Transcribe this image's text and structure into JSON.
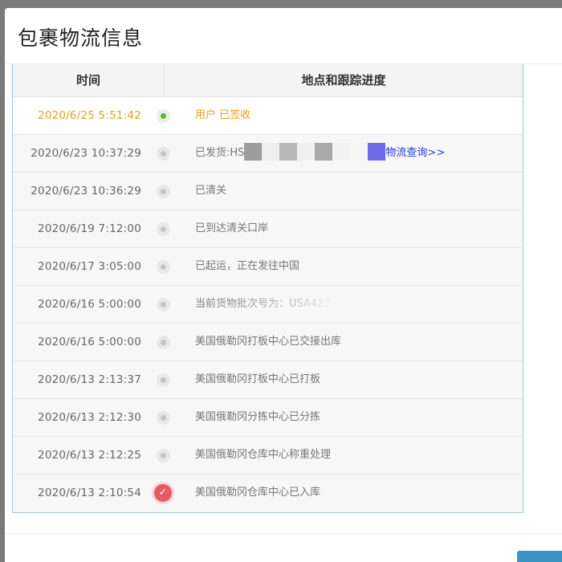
{
  "modal": {
    "title": "包裹物流信息"
  },
  "table": {
    "headers": {
      "time": "时间",
      "location": "地点和跟踪进度"
    },
    "rows": [
      {
        "time": "2020/6/25 5:51:42",
        "desc": "用户 已签收"
      },
      {
        "time": "2020/6/23 10:37:29",
        "desc_prefix": "已发货:HS",
        "link": "物流查询>>"
      },
      {
        "time": "2020/6/23 10:36:29",
        "desc": "已清关"
      },
      {
        "time": "2020/6/19 7:12:00",
        "desc": "已到达清关口岸"
      },
      {
        "time": "2020/6/17 3:05:00",
        "desc": "已起运，正在发往中国"
      },
      {
        "time": "2020/6/16 5:00:00",
        "desc": "当前货物批次号为：USA423"
      },
      {
        "time": "2020/6/16 5:00:00",
        "desc": "美国俄勒冈打板中心已交接出库"
      },
      {
        "time": "2020/6/13 2:13:37",
        "desc": "美国俄勒冈打板中心已打板"
      },
      {
        "time": "2020/6/13 2:12:30",
        "desc": "美国俄勒冈分拣中心已分拣"
      },
      {
        "time": "2020/6/13 2:12:25",
        "desc": "美国俄勒冈仓库中心称重处理"
      },
      {
        "time": "2020/6/13 2:10:54",
        "desc": "美国俄勒冈仓库中心已入库"
      }
    ]
  },
  "colors": {
    "accent": "#e7a01a",
    "signed_dot": "#52c41a",
    "origin_dot": "#e85a63",
    "link": "#1f3ddb"
  },
  "icons": {
    "first": "green-dot-icon",
    "middle": "grey-dot-icon",
    "last": "check-circle-icon"
  }
}
